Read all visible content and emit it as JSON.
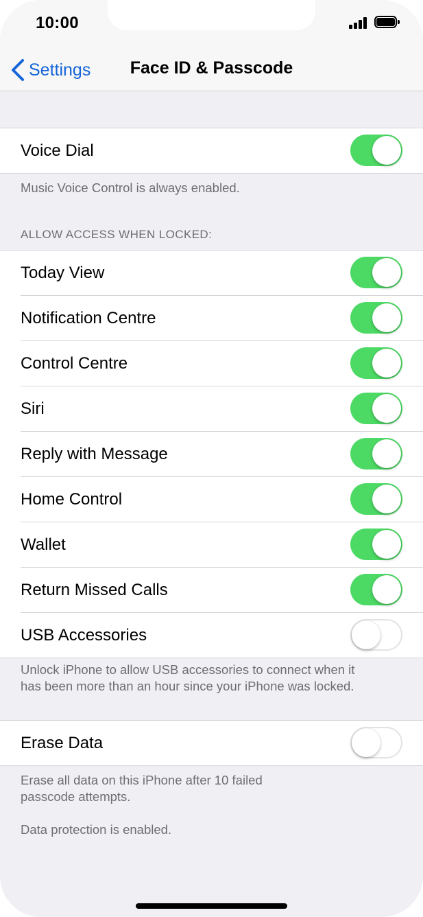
{
  "status_bar": {
    "time": "10:00",
    "battery_level": 0.9
  },
  "nav": {
    "back_label": "Settings",
    "title": "Face ID & Passcode"
  },
  "voice_dial": {
    "label": "Voice Dial",
    "on": true
  },
  "voice_footer": "Music Voice Control is always enabled.",
  "locked_header": "ALLOW ACCESS WHEN LOCKED:",
  "locked_items": [
    {
      "label": "Today View",
      "on": true
    },
    {
      "label": "Notification Centre",
      "on": true
    },
    {
      "label": "Control Centre",
      "on": true
    },
    {
      "label": "Siri",
      "on": true
    },
    {
      "label": "Reply with Message",
      "on": true
    },
    {
      "label": "Home Control",
      "on": true
    },
    {
      "label": "Wallet",
      "on": true
    },
    {
      "label": "Return Missed Calls",
      "on": true
    },
    {
      "label": "USB Accessories",
      "on": false
    }
  ],
  "usb_footer_line1": "Unlock iPhone to allow USB accessories to connect when it",
  "usb_footer_line2": "has been more than an hour since your iPhone was locked.",
  "erase": {
    "label": "Erase Data",
    "on": false
  },
  "erase_footer_line1": "Erase all data on this iPhone after 10 failed",
  "erase_footer_line2": "passcode attempts.",
  "protection_text": "Data protection is enabled.",
  "colors": {
    "accent": "#1565d8",
    "toggle_on": "#4cd964",
    "background": "#efeff4"
  }
}
